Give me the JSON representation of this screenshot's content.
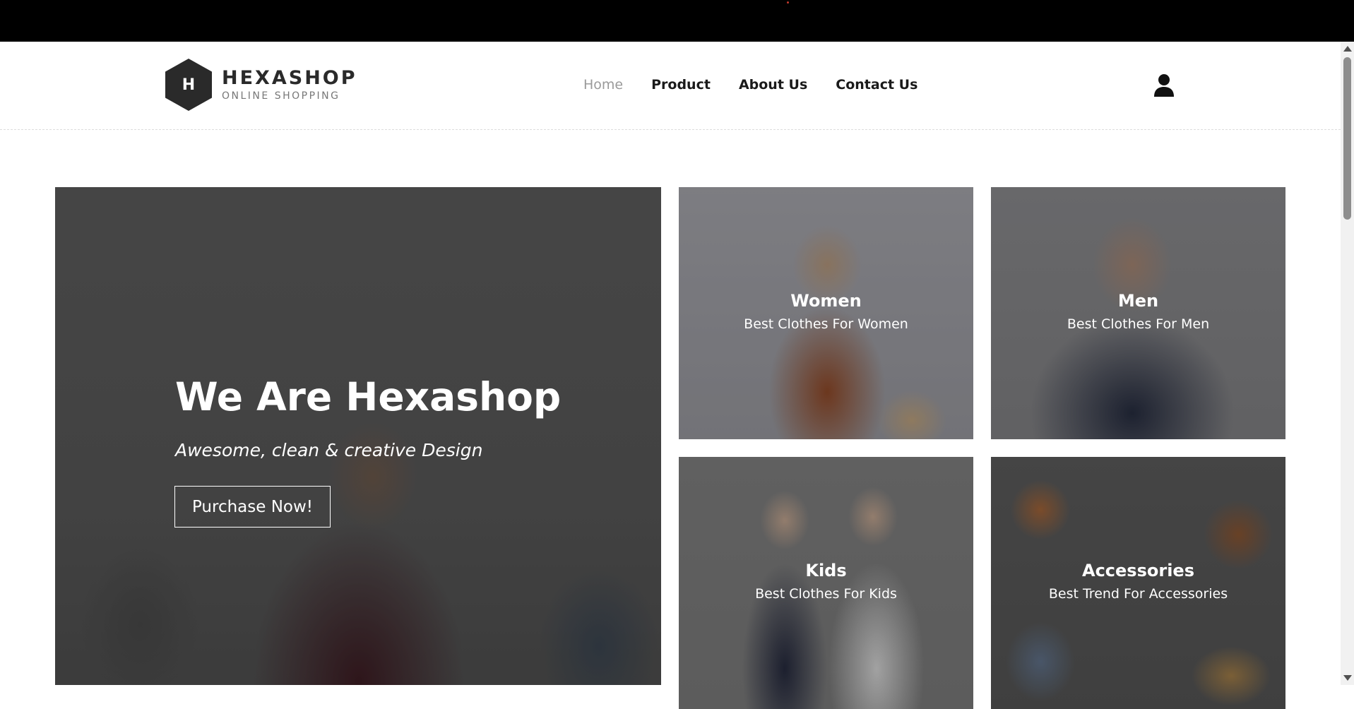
{
  "brand": {
    "letter": "H",
    "name": "HEXASHOP",
    "tagline": "ONLINE SHOPPING"
  },
  "nav": [
    {
      "label": "Home",
      "active": true
    },
    {
      "label": "Product",
      "active": false
    },
    {
      "label": "About Us",
      "active": false
    },
    {
      "label": "Contact Us",
      "active": false
    }
  ],
  "hero": {
    "title": "We Are Hexashop",
    "subtitle": "Awesome, clean & creative Design",
    "button": "Purchase Now!"
  },
  "categories": [
    {
      "title": "Women",
      "subtitle": "Best Clothes For Women"
    },
    {
      "title": "Men",
      "subtitle": "Best Clothes For Men"
    },
    {
      "title": "Kids",
      "subtitle": "Best Clothes For Kids"
    },
    {
      "title": "Accessories",
      "subtitle": "Best Trend For Accessories"
    }
  ],
  "icons": {
    "user": "user-icon",
    "logo": "hexagon-logo-icon"
  },
  "colors": {
    "nav_active": "#9a9a9a",
    "nav_text": "#1a1a1a",
    "logo_dark": "#2a2a2a"
  }
}
